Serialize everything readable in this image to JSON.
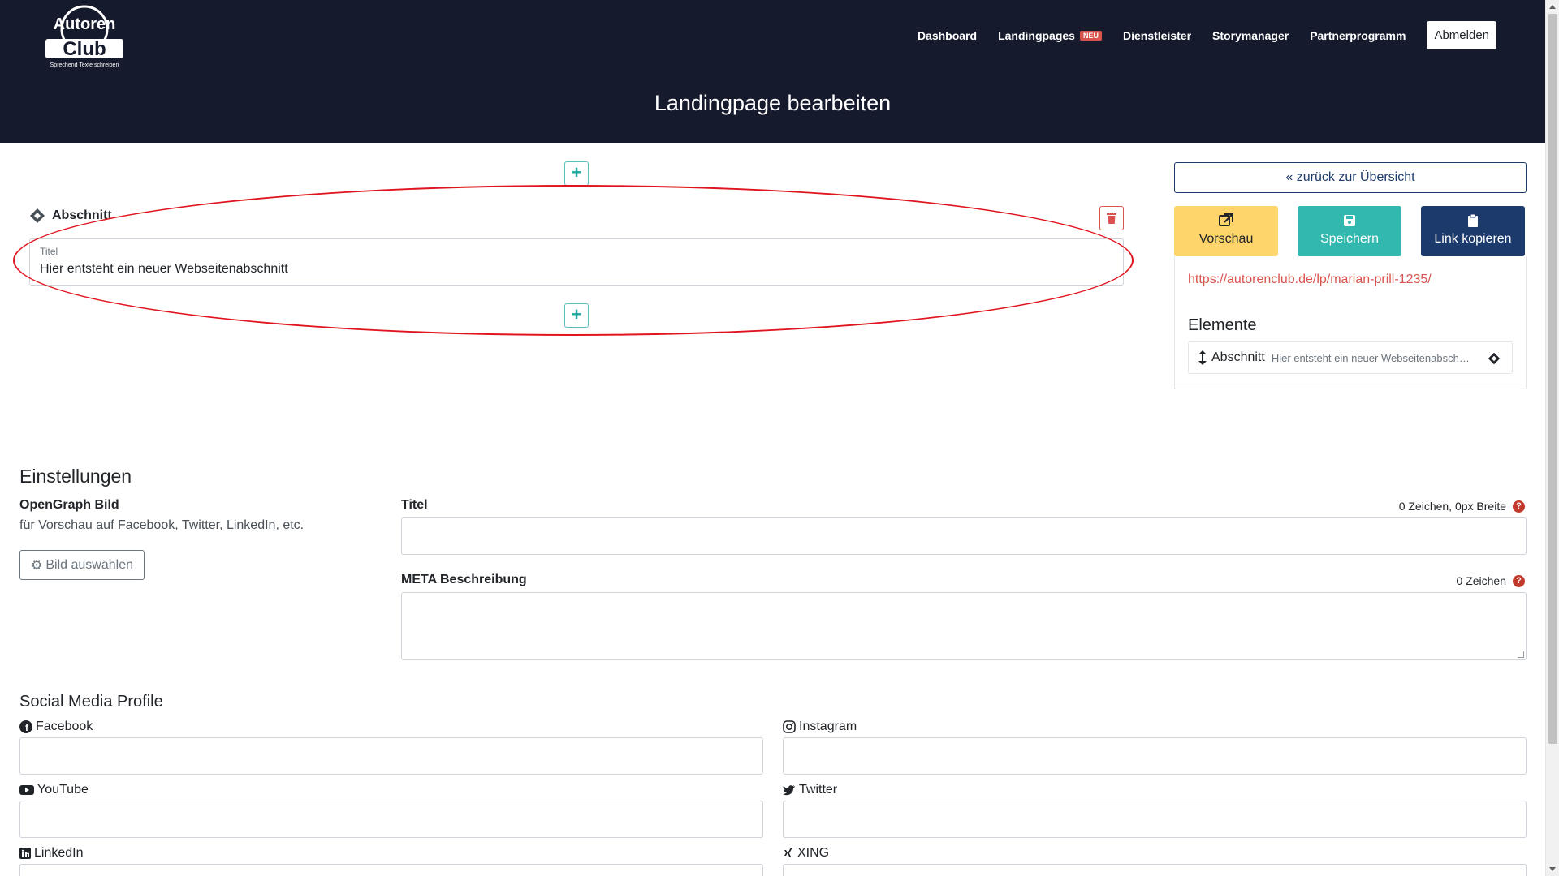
{
  "header": {
    "logo_text": "Autoren Club",
    "logo_tagline": "Sprechend Texte schreiben",
    "nav": [
      {
        "label": "Dashboard"
      },
      {
        "label": "Landingpages",
        "badge": "NEU"
      },
      {
        "label": "Dienstleister"
      },
      {
        "label": "Storymanager"
      },
      {
        "label": "Partnerprogramm"
      }
    ],
    "logout_label": "Abmelden",
    "page_title": "Landingpage bearbeiten"
  },
  "editor": {
    "add_symbol": "+",
    "section_label": "Abschnitt",
    "title_field_label": "Titel",
    "title_field_value": "Hier entsteht ein neuer Webseitenabschnitt"
  },
  "right_panel": {
    "back_label": "« zurück zur Übersicht",
    "preview_label": "Vorschau",
    "save_label": "Speichern",
    "copy_label": "Link kopieren",
    "link": "https://autorenclub.de/lp/marian-prill-1235/",
    "elements_title": "Elemente",
    "elements": [
      {
        "label": "Abschnitt",
        "desc": "Hier entsteht ein neuer Webseitenabschnitt"
      }
    ]
  },
  "settings": {
    "title": "Einstellungen",
    "og_label": "OpenGraph Bild",
    "og_desc": "für Vorschau auf Facebook, Twitter, LinkedIn, etc.",
    "img_button": "Bild auswählen",
    "title_label": "Titel",
    "title_counter": "0 Zeichen, 0px Breite",
    "title_value": "",
    "meta_label": "META Beschreibung",
    "meta_counter": "0 Zeichen",
    "meta_value": "",
    "help_symbol": "?"
  },
  "social": {
    "title": "Social Media Profile",
    "facebook": "Facebook",
    "instagram": "Instagram",
    "youtube": "YouTube",
    "twitter": "Twitter",
    "linkedin": "LinkedIn",
    "xing": "XING"
  },
  "colors": {
    "header_bg": "#161a2d",
    "preview": "#fdd56b",
    "save": "#32b8ae",
    "copy": "#1c3a6b",
    "link": "#d9534f",
    "annotation": "#e0141e"
  }
}
